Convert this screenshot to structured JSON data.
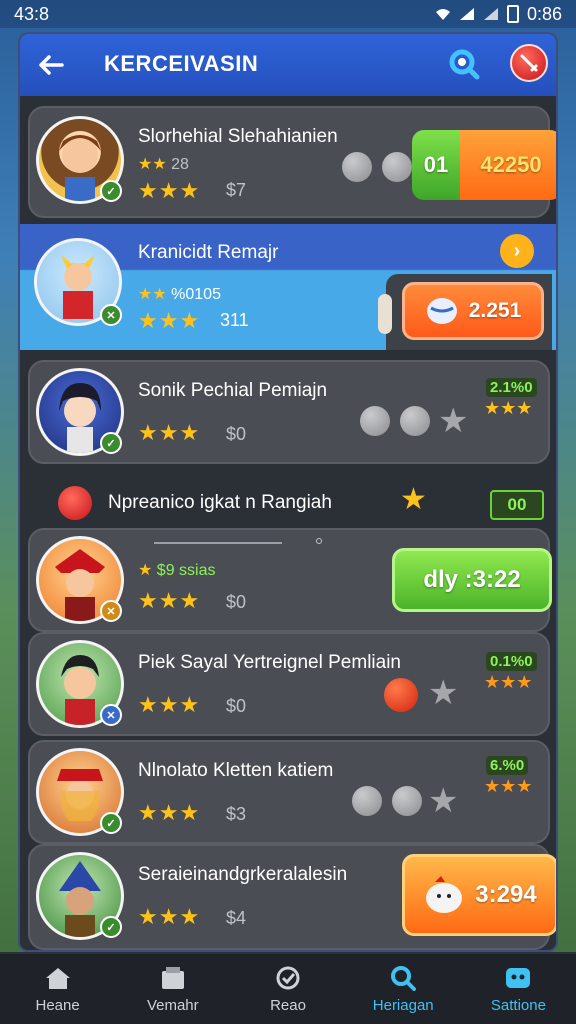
{
  "status": {
    "time": "43:8",
    "battery": "0:86"
  },
  "header": {
    "title": "KERCEIVASIN"
  },
  "cards": [
    {
      "name": "Slorhehial Slehahianien",
      "small_rating": "28",
      "price": "$7",
      "button": {
        "left": "01",
        "right": "42250"
      }
    },
    {
      "name": "Kranicidt Remajr",
      "small_rating": "%0105",
      "price": "311",
      "button": {
        "value": "2.251"
      }
    },
    {
      "name": "Sonik Pechial Pemiajn",
      "price": "$0",
      "badge": "2.1%0"
    },
    {
      "name": "",
      "small_rating": "$9 ssias",
      "price": "$0",
      "button": {
        "value": "dly :3:22"
      }
    },
    {
      "name": "Piek Sayal Yertreignel Pemliain",
      "price": "$0",
      "badge": "0.1%0"
    },
    {
      "name": "Nlnolato Kletten katiem",
      "price": "$3",
      "badge": "6.%0"
    },
    {
      "name": "Seraieinandgrkeralalesin",
      "price": "$4",
      "button": {
        "value": "3:294"
      }
    }
  ],
  "section": {
    "label": "Npreanico igkat n Rangiah",
    "badge": "00"
  },
  "tabs": [
    {
      "label": "Heane",
      "icon": "home-icon"
    },
    {
      "label": "Vemahr",
      "icon": "shop-icon"
    },
    {
      "label": "Reao",
      "icon": "badge-icon"
    },
    {
      "label": "Heriagan",
      "icon": "search-icon",
      "active": true
    },
    {
      "label": "Sattione",
      "icon": "controller-icon"
    }
  ],
  "colors": {
    "accent": "#2f63d8",
    "active_tab": "#3fc1f2",
    "star": "#ffc21a",
    "green_btn": "#6bd33a",
    "orange_btn": "#ff7b1c"
  }
}
